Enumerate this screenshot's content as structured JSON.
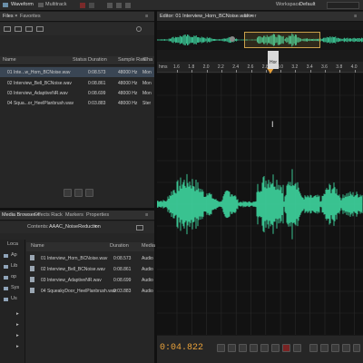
{
  "topbar": {
    "mode_waveform": "Waveform",
    "mode_multitrack": "Multitrack",
    "workspace_label": "Workspace:",
    "workspace_value": "Default"
  },
  "files_panel": {
    "tab_files": "Files ×",
    "tab_favorites": "Favorites",
    "columns": [
      "Name",
      "Status",
      "Duration",
      "Sample Rate",
      "Cha"
    ],
    "files": [
      {
        "name": "01 Inte...w_Horn_BCNoise.wav",
        "duration": "0:08.573",
        "rate": "48000 Hz",
        "ch": "Mon"
      },
      {
        "name": "02 Interview_Bell_BCNoise.wav",
        "duration": "0:08.861",
        "rate": "48000 Hz",
        "ch": "Mon"
      },
      {
        "name": "03 Interview_AdaptiveNR.wav",
        "duration": "0:08.699",
        "rate": "48000 Hz",
        "ch": "Mon"
      },
      {
        "name": "04 Squa...or_HeelPlanbrush.wav",
        "duration": "0:03.883",
        "rate": "48000 Hz",
        "ch": "Ster"
      }
    ]
  },
  "media_panel": {
    "tabs": [
      "Media Browser ×",
      "Effects Rack",
      "Markers",
      "Properties"
    ],
    "contents_label": "Contents:",
    "contents_value": "AAAC_NoiseReduction",
    "tree_header": "Loca",
    "tree_items": [
      "Ap",
      "Lib",
      "op",
      "Sys",
      "Us"
    ],
    "columns": [
      "Name",
      "Duration",
      "Media"
    ],
    "items": [
      {
        "name": "01 Interview_Horn_BCNoise.wav",
        "duration": "0:08.573",
        "media": "Audio"
      },
      {
        "name": "02 Interview_Bell_BCNoise.wav",
        "duration": "0:08.861",
        "media": "Audio"
      },
      {
        "name": "03 Interview_AdaptiveNR.wav",
        "duration": "0:08.699",
        "media": "Audio"
      },
      {
        "name": "04 SqueakyDoor_HeelPlanbrush.wav",
        "duration": "0:03.883",
        "media": "Audio"
      }
    ]
  },
  "editor": {
    "tab_editor": "Editor: 01 Interview_Horn_BCNoise.wav ×",
    "tab_mixer": "Mixer",
    "ruler_unit": "hms",
    "ruler_labels": [
      "1.6",
      "1.8",
      "2.0",
      "2.2",
      "2.4",
      "2.6",
      "2.8",
      "3.0",
      "3.2",
      "3.4",
      "3.6",
      "3.8",
      "4.0",
      "4.2",
      "4.4",
      "4.6",
      "4.8",
      "5.0",
      "5.2",
      "5.4"
    ],
    "playhead_tooltip": "Hor",
    "timecode": "0:04.822",
    "colors": {
      "waveform": "#3fd6a0",
      "accent": "#e8a13a"
    }
  }
}
